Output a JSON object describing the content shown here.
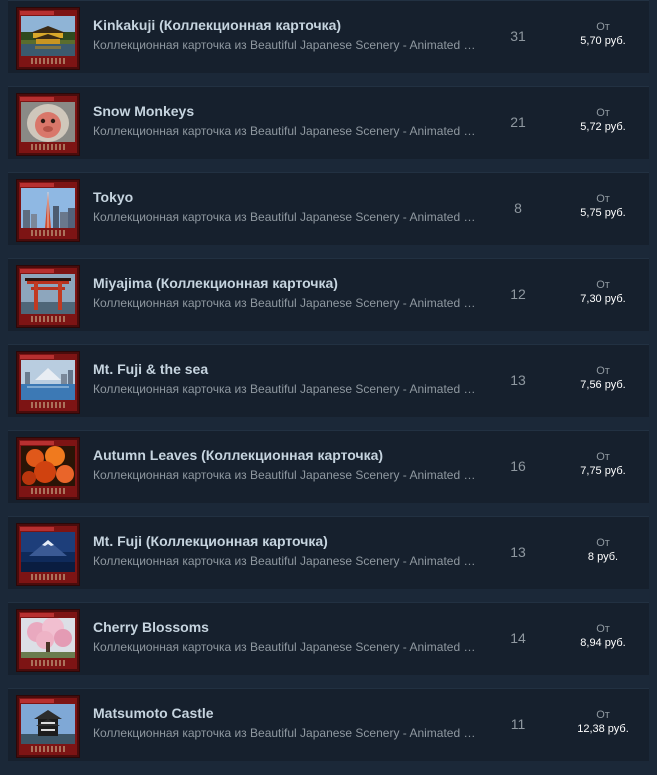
{
  "listings": [
    {
      "name": "Kinkakuji (Коллекционная карточка)",
      "description": "Коллекционная карточка из Beautiful Japanese Scenery - Animated Wallpapers",
      "quantity": "31",
      "price_prefix": "От",
      "price": "5,70 руб.",
      "art": "golden-pavilion"
    },
    {
      "name": "Snow Monkeys",
      "description": "Коллекционная карточка из Beautiful Japanese Scenery - Animated Wallpapers",
      "quantity": "21",
      "price_prefix": "От",
      "price": "5,72 руб.",
      "art": "monkey-face"
    },
    {
      "name": "Tokyo",
      "description": "Коллекционная карточка из Beautiful Japanese Scenery - Animated Wallpapers",
      "quantity": "8",
      "price_prefix": "От",
      "price": "5,75 руб.",
      "art": "city-skyline"
    },
    {
      "name": "Miyajima (Коллекционная карточка)",
      "description": "Коллекционная карточка из Beautiful Japanese Scenery - Animated Wallpapers",
      "quantity": "12",
      "price_prefix": "От",
      "price": "7,30 руб.",
      "art": "torii-gate"
    },
    {
      "name": "Mt. Fuji & the sea",
      "description": "Коллекционная карточка из Beautiful Japanese Scenery - Animated Wallpapers",
      "quantity": "13",
      "price_prefix": "От",
      "price": "7,56 руб.",
      "art": "fuji-sea"
    },
    {
      "name": "Autumn Leaves (Коллекционная карточка)",
      "description": "Коллекционная карточка из Beautiful Japanese Scenery - Animated Wallpapers",
      "quantity": "16",
      "price_prefix": "От",
      "price": "7,75 руб.",
      "art": "maple-leaves"
    },
    {
      "name": "Mt. Fuji (Коллекционная карточка)",
      "description": "Коллекционная карточка из Beautiful Japanese Scenery - Animated Wallpapers",
      "quantity": "13",
      "price_prefix": "От",
      "price": "8 руб.",
      "art": "fuji-night"
    },
    {
      "name": "Cherry Blossoms",
      "description": "Коллекционная карточка из Beautiful Japanese Scenery - Animated Wallpapers",
      "quantity": "14",
      "price_prefix": "От",
      "price": "8,94 руб.",
      "art": "sakura-tree"
    },
    {
      "name": "Matsumoto Castle",
      "description": "Коллекционная карточка из Beautiful Japanese Scenery - Animated Wallpapers",
      "quantity": "11",
      "price_prefix": "От",
      "price": "12,38 руб.",
      "art": "castle"
    }
  ]
}
